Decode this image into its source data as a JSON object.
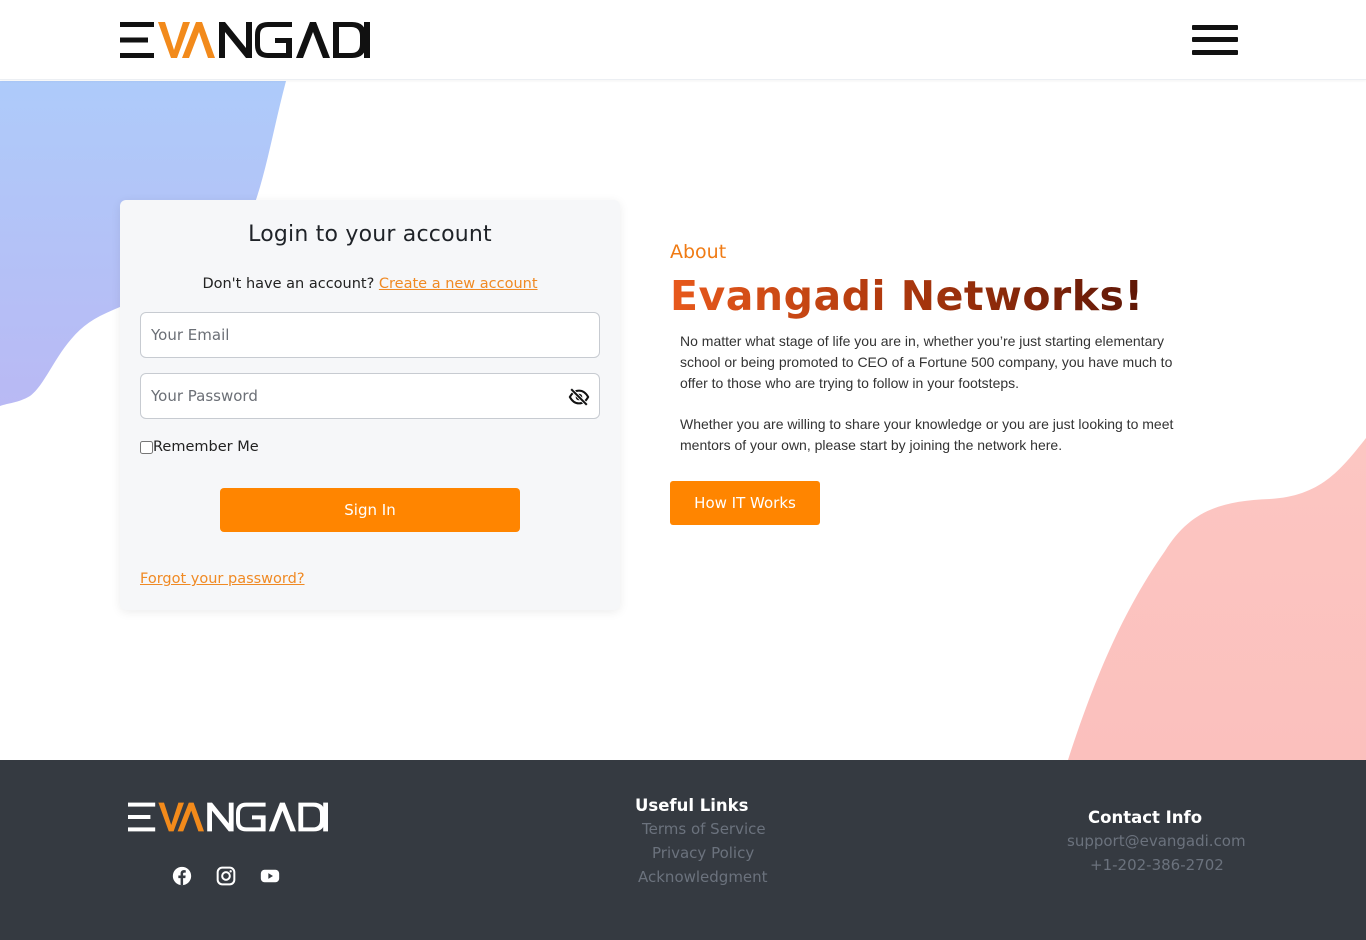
{
  "header": {
    "logo_text": "EVANGADI",
    "menu_icon": "hamburger-menu-icon"
  },
  "login": {
    "title": "Login to your account",
    "signup_prompt": "Don't have an account?",
    "signup_link": "Create a new account",
    "email_placeholder": "Your Email",
    "password_placeholder": "Your Password",
    "password_toggle_icon": "eye-slash-icon",
    "remember_label": "Remember Me",
    "signin_label": "Sign In",
    "forgot_label": "Forgot your password?"
  },
  "about": {
    "label": "About",
    "title": "Evangadi Networks!",
    "paragraph1": "No matter what stage of life you are in, whether you’re just starting elementary school or being promoted to CEO of a Fortune 500 company, you have much to offer to those who are trying to follow in your footsteps.",
    "paragraph2": "Whether you are willing to share your knowledge or you are just looking to meet mentors of your own, please start by joining the network here.",
    "button_label": "How IT Works"
  },
  "footer": {
    "logo_text": "EVANGADI",
    "socials": [
      "facebook-icon",
      "instagram-icon",
      "youtube-icon"
    ],
    "links_heading": "Useful Links",
    "links": [
      "Terms of Service",
      "Privacy Policy",
      "Acknowledgment"
    ],
    "contact_heading": "Contact Info",
    "email": "support@evangadi.com",
    "phone": "+1-202-386-2702"
  },
  "colors": {
    "accent": "#ff8500",
    "link": "#f08a24",
    "footer_bg": "#353a41",
    "blob_blue": "#aec7fa",
    "blob_pink": "#fcc2c0"
  }
}
